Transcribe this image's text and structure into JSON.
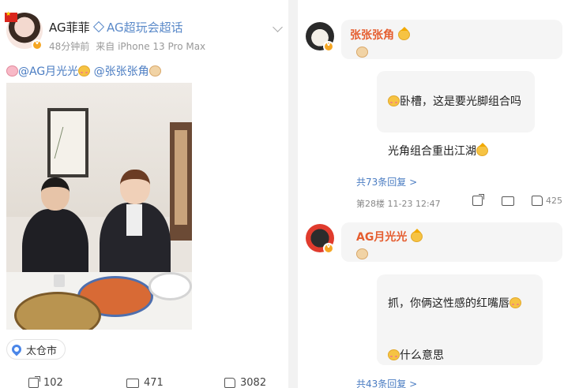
{
  "post": {
    "username": "AG菲菲",
    "super_topic": "AG超玩会超话",
    "time": "48分钟前",
    "source": "来自 iPhone 13 Pro Max",
    "mention1": "@AG月光光",
    "mention2": "@张张张角",
    "location": "太仓市",
    "share_count": "102",
    "comment_count": "471",
    "like_count": "3082"
  },
  "comments": [
    {
      "name": "张张张角",
      "replies": [
        {
          "text": "卧槽，这是要光脚组合吗"
        },
        {
          "text": "光角组合重出江湖"
        }
      ],
      "more": "共73条回复 >",
      "floor_meta": "第28楼 11-23 12:47",
      "likes": "425"
    },
    {
      "name": "AG月光光",
      "replies": [
        {
          "text": "抓，你俩这性感的红嘴唇"
        },
        {
          "text": "什么意思"
        }
      ],
      "more": "共43条回复 >"
    }
  ],
  "colors": {
    "mention": "#4a7cc2",
    "comment_name": "#e55d2f",
    "super_topic": "#5b8ac9"
  }
}
